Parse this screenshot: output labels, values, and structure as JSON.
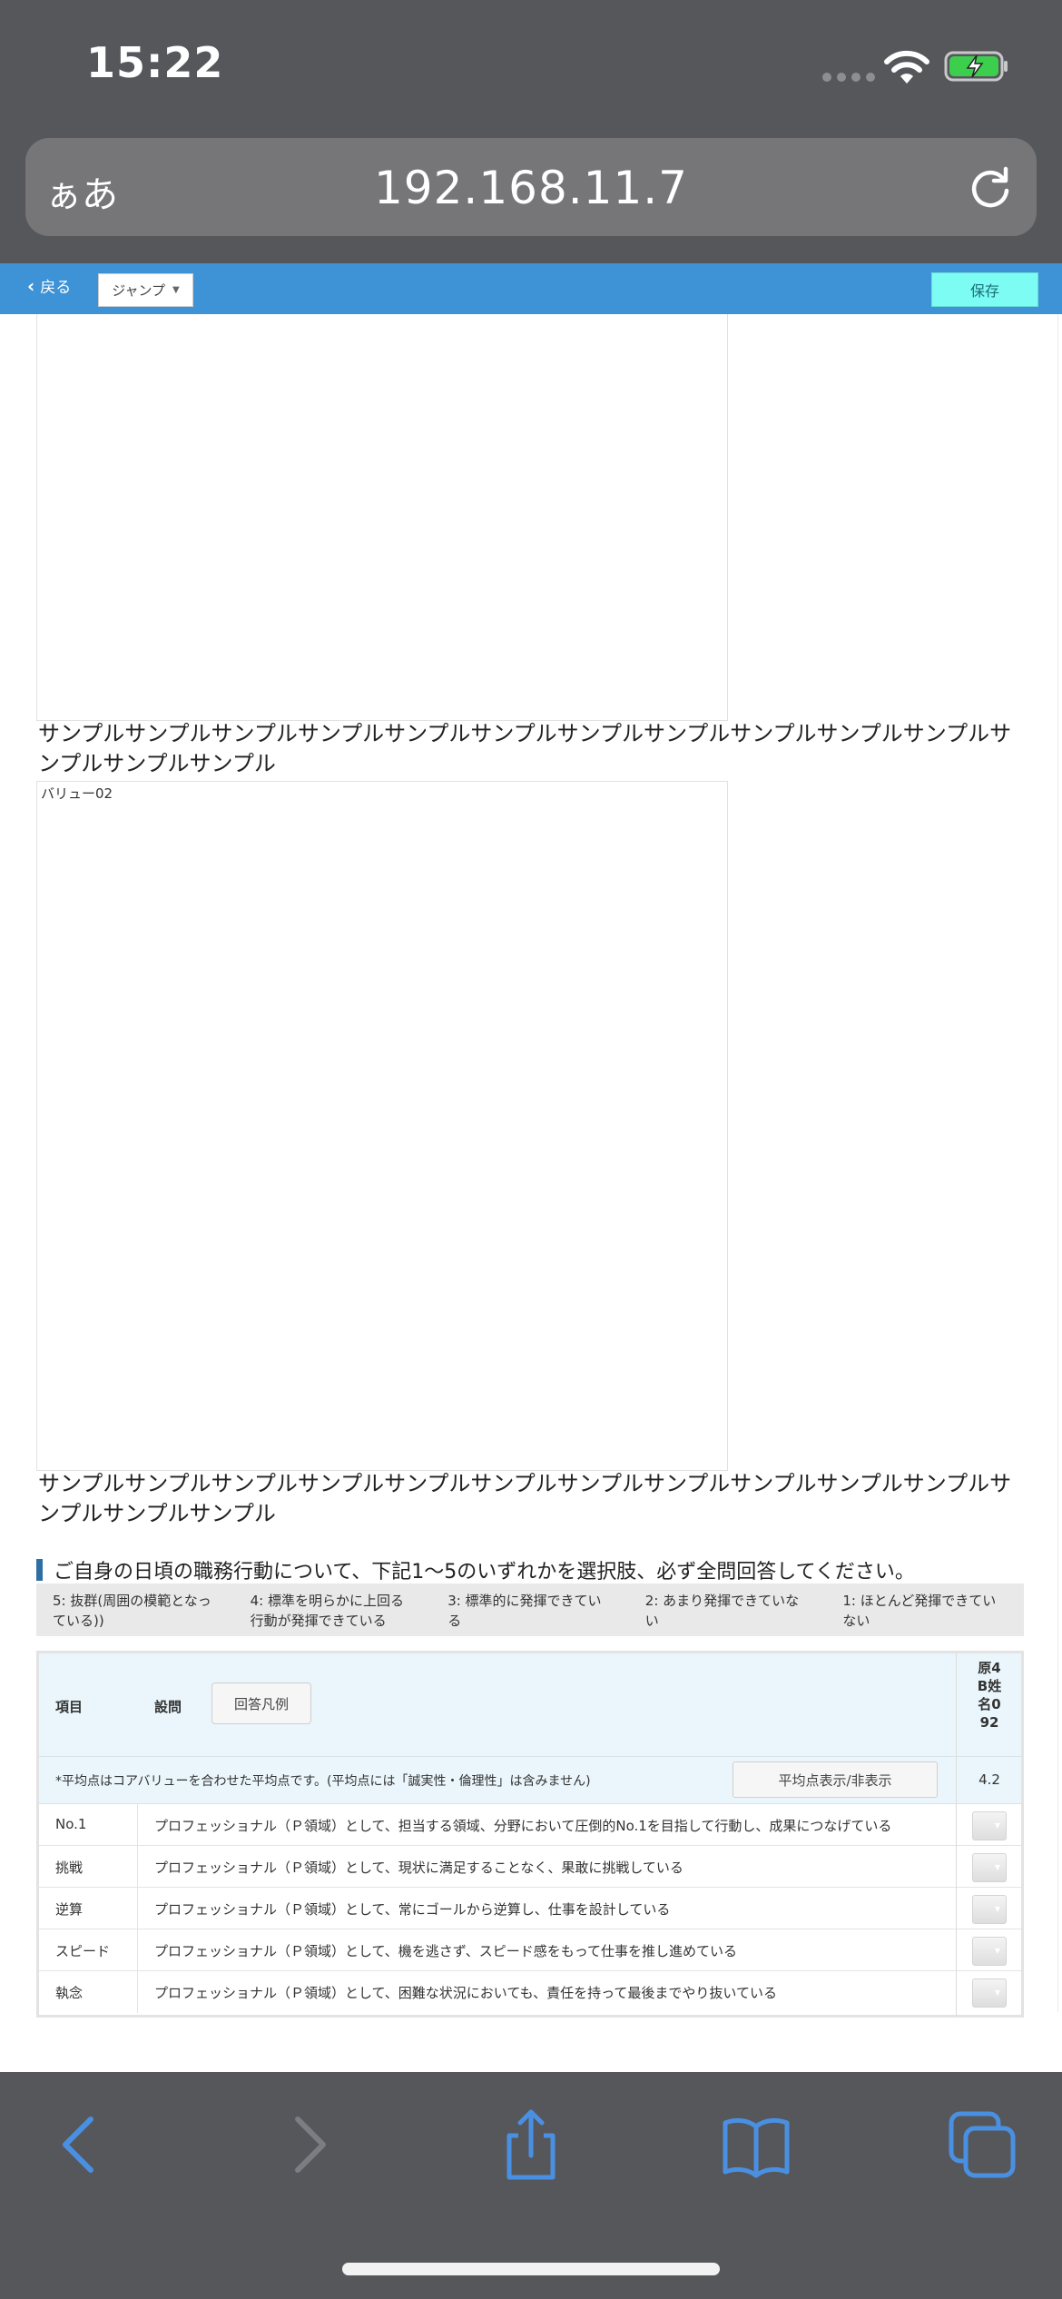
{
  "status_bar": {
    "time": "15:22"
  },
  "browser": {
    "aa_label": "ぁあ",
    "url": "192.168.11.7"
  },
  "toolbar": {
    "back_label": "戻る",
    "jump_label": "ジャンプ",
    "save_label": "保存"
  },
  "content": {
    "frame2_label": "バリュー02",
    "sample_text_1": "サンプルサンプルサンプルサンプルサンプルサンプルサンプルサンプルサンプルサンプルサンプルサンプルサンプルサンプル",
    "sample_text_2": "サンプルサンプルサンプルサンプルサンプルサンプルサンプルサンプルサンプルサンプルサンプルサンプルサンプルサンプル",
    "instruction": "ご自身の日頃の職務行動について、下記1〜5のいずれかを選択肢、必ず全問回答してください。"
  },
  "scale": [
    "5: 抜群(周囲の模範となっている))",
    "4: 標準を明らかに上回る行動が発揮できている",
    "3: 標準的に発揮できている",
    "2: あまり発揮できていない",
    "1: ほとんど発揮できていない"
  ],
  "table": {
    "header_item": "項目",
    "header_question": "設問",
    "legend_button": "回答凡例",
    "name_column": "原4B姓名092",
    "avg_note": "*平均点はコアバリューを合わせた平均点です。(平均点には「誠実性・倫理性」は含みません)",
    "avg_toggle_button": "平均点表示/非表示",
    "avg_value": "4.2",
    "rows": [
      {
        "item": "No.1",
        "question": "プロフェッショナル（Ｐ領域）として、担当する領域、分野において圧倒的No.1を目指して行動し、成果につなげている"
      },
      {
        "item": "挑戦",
        "question": "プロフェッショナル（Ｐ領域）として、現状に満足することなく、果敢に挑戦している"
      },
      {
        "item": "逆算",
        "question": "プロフェッショナル（Ｐ領域）として、常にゴールから逆算し、仕事を設計している"
      },
      {
        "item": "スピード",
        "question": "プロフェッショナル（Ｐ領域）として、機を逃さず、スピード感をもって仕事を推し進めている"
      },
      {
        "item": "執念",
        "question": "プロフェッショナル（Ｐ領域）として、困難な状況においても、責任を持って最後までやり抜いている"
      }
    ]
  },
  "colors": {
    "toolbar": "#3e92d6",
    "save_button": "#7dfcf3",
    "chrome": "#56575b",
    "ios_blue": "#4a90e2"
  }
}
